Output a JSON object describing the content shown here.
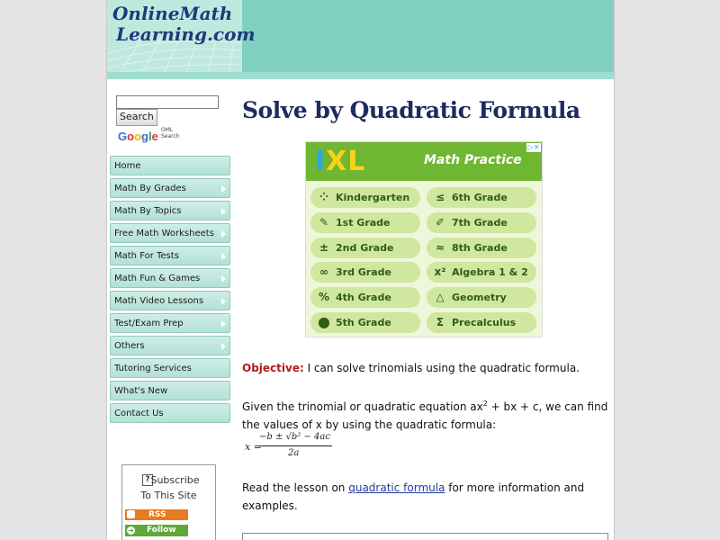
{
  "site": {
    "logo_line1": "OnlineMath",
    "logo_line2": "Learning.com"
  },
  "search": {
    "button_label": "Search",
    "google_brand": "Google",
    "google_sub": "OML Search",
    "placeholder": ""
  },
  "nav": {
    "items": [
      {
        "label": "Home",
        "arrow": false
      },
      {
        "label": "Math By Grades",
        "arrow": true
      },
      {
        "label": "Math By Topics",
        "arrow": true
      },
      {
        "label": "Free Math Worksheets",
        "arrow": true
      },
      {
        "label": "Math For Tests",
        "arrow": true
      },
      {
        "label": "Math Fun & Games",
        "arrow": true
      },
      {
        "label": "Math Video Lessons",
        "arrow": true
      },
      {
        "label": "Test/Exam Prep",
        "arrow": true
      },
      {
        "label": "Others",
        "arrow": true
      },
      {
        "label": "Tutoring Services",
        "arrow": false
      },
      {
        "label": "What's New",
        "arrow": false
      },
      {
        "label": "Contact Us",
        "arrow": false
      }
    ]
  },
  "subscribe": {
    "line1": "Subscribe",
    "line2": "To This Site",
    "rss_label": "RSS",
    "follow_label": "Follow"
  },
  "main": {
    "title": "Solve by Quadratic Formula",
    "objective_label": "Objective:",
    "objective_text": " I can solve trinomials using the quadratic formula.",
    "given_text_a": "Given the trinomial or quadratic equation ax",
    "given_sup": "2",
    "given_text_b": " + bx + c, we can find the values of x by using the quadratic formula:",
    "formula_lhs": "x =",
    "formula_numerator": "−b ± √b² − 4ac",
    "formula_denominator": "2a",
    "read_prefix": "Read the lesson on ",
    "read_link": "quadratic formula",
    "read_suffix": " for more information and examples."
  },
  "ad": {
    "logo": [
      "I",
      "X",
      "L"
    ],
    "title": "Math Practice",
    "close_label": "▷✕",
    "left_column": [
      {
        "icon": "⁘",
        "label": "Kindergarten"
      },
      {
        "icon": "✎",
        "label": "1st Grade"
      },
      {
        "icon": "±",
        "label": "2nd Grade"
      },
      {
        "icon": "∞",
        "label": "3rd Grade"
      },
      {
        "icon": "%",
        "label": "4th Grade"
      },
      {
        "icon": "⬤",
        "label": "5th Grade"
      }
    ],
    "right_column": [
      {
        "icon": "≤",
        "label": "6th Grade"
      },
      {
        "icon": "✐",
        "label": "7th Grade"
      },
      {
        "icon": "≈",
        "label": "8th Grade"
      },
      {
        "icon": "x²",
        "label": "Algebra 1 & 2"
      },
      {
        "icon": "△",
        "label": "Geometry"
      },
      {
        "icon": "Σ",
        "label": "Precalculus"
      }
    ]
  }
}
